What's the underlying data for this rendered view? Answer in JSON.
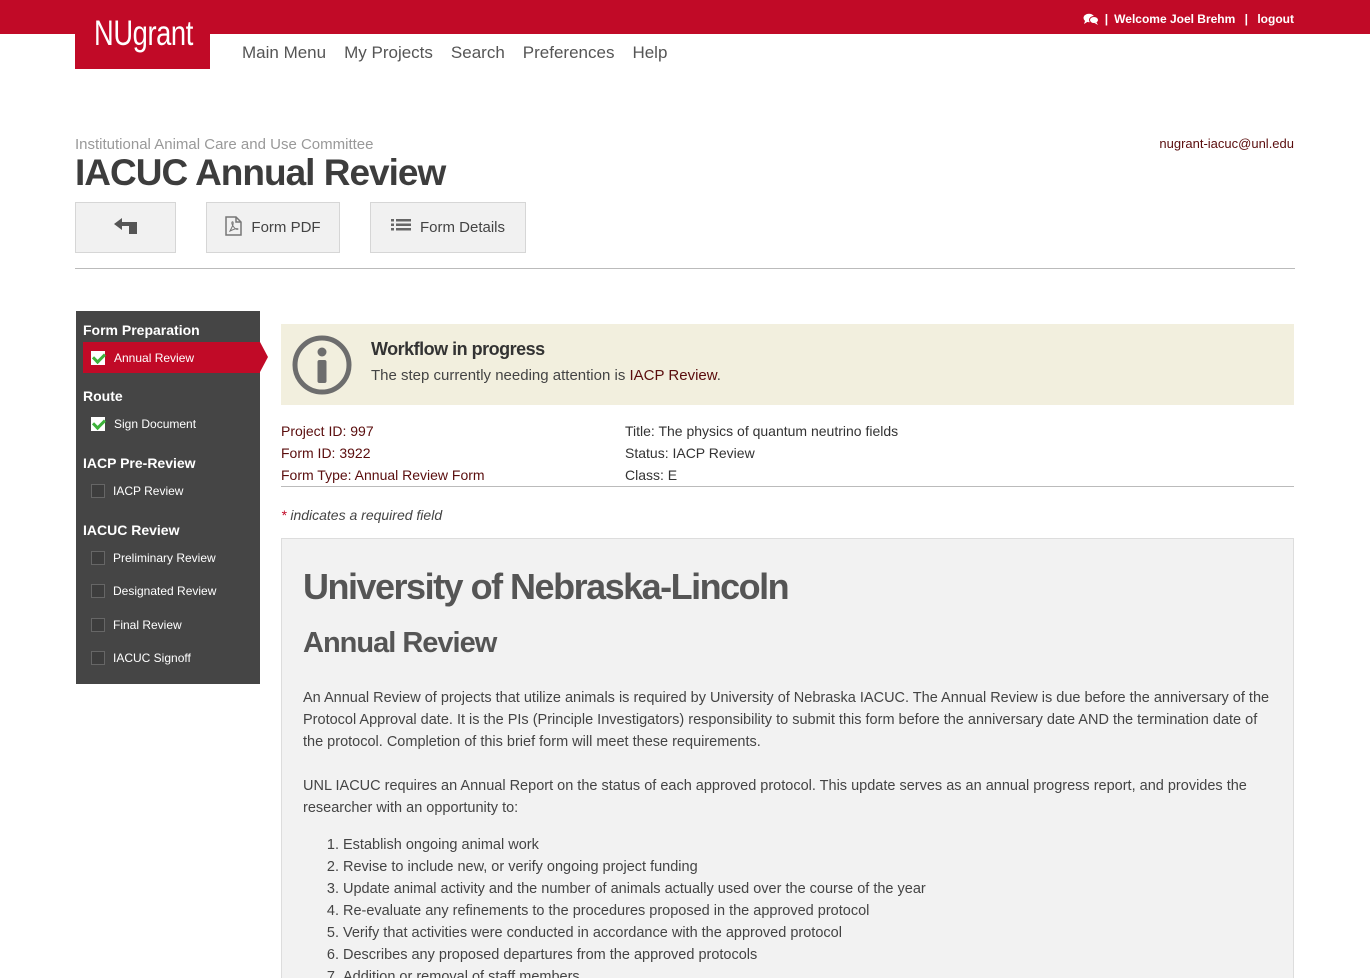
{
  "brand": {
    "logo": "NUgrant",
    "color": "#c10a27"
  },
  "user": {
    "welcome": "Welcome Joel Brehm",
    "logout": "logout",
    "chat_icon": "chat-icon"
  },
  "nav": [
    "Main Menu",
    "My Projects",
    "Search",
    "Preferences",
    "Help"
  ],
  "header": {
    "committee": "Institutional Animal Care and Use Committee",
    "title": "IACUC Annual Review",
    "email": "nugrant-iacuc@unl.edu"
  },
  "toolbar": {
    "back_icon": "back-arrow-icon",
    "pdf_label": "Form PDF",
    "details_label": "Form Details"
  },
  "sidebar": {
    "sections": [
      {
        "heading": "Form Preparation",
        "items": [
          {
            "label": "Annual Review",
            "done": true,
            "active": true
          }
        ]
      },
      {
        "heading": "Route",
        "items": [
          {
            "label": "Sign Document",
            "done": true,
            "active": false
          }
        ]
      },
      {
        "heading": "IACP Pre-Review",
        "items": [
          {
            "label": "IACP Review",
            "done": false,
            "active": false
          }
        ]
      },
      {
        "heading": "IACUC Review",
        "items": [
          {
            "label": "Preliminary Review",
            "done": false,
            "active": false
          },
          {
            "label": "Designated Review",
            "done": false,
            "active": false
          },
          {
            "label": "Final Review",
            "done": false,
            "active": false
          },
          {
            "label": "IACUC Signoff",
            "done": false,
            "active": false
          }
        ]
      }
    ]
  },
  "alert": {
    "title": "Workflow in progress",
    "text_prefix": "The step currently needing attention is ",
    "step": "IACP Review",
    "text_suffix": "."
  },
  "meta": {
    "project_id": "Project ID: 997",
    "form_id": "Form ID: 3922",
    "form_type": "Form Type: Annual Review Form",
    "title": "Title: The physics of quantum neutrino fields",
    "status": "Status: IACP Review",
    "class": "Class: E"
  },
  "required_note": {
    "star": "*",
    "text": " indicates a required field"
  },
  "form": {
    "h1": "University of Nebraska-Lincoln",
    "h2": "Annual Review",
    "p1": "An Annual Review of projects that utilize animals is required by University of Nebraska IACUC. The Annual Review is due before the anniversary of the Protocol Approval date. It is the PIs (Principle Investigators) responsibility to submit this form before the anniversary date AND the termination date of the protocol. Completion of this brief form will meet these requirements.",
    "p2": "UNL IACUC requires an Annual Report on the status of each approved protocol. This update serves as an annual progress report, and provides the researcher with an opportunity to:",
    "list": [
      "Establish ongoing animal work",
      "Revise to include new, or verify ongoing project funding",
      "Update animal activity and the number of animals actually used over the course of the year",
      "Re-evaluate any refinements to the procedures proposed in the approved protocol",
      "Verify that activities were conducted in accordance with the approved protocol",
      "Describes any proposed departures from the approved protocols",
      "Addition or removal of staff members"
    ]
  }
}
